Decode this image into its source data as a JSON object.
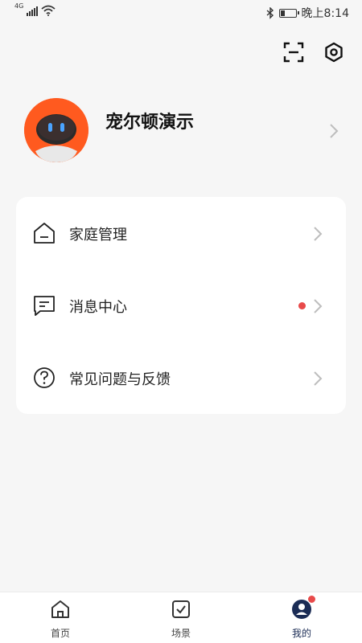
{
  "status_bar": {
    "network": "4G",
    "time": "晚上8:14",
    "battery_level": 0.35
  },
  "header": {
    "icons": [
      "scan-icon",
      "settings-icon"
    ]
  },
  "profile": {
    "username": "宠尔顿演示"
  },
  "menu": {
    "items": [
      {
        "label": "家庭管理",
        "icon": "home-icon"
      },
      {
        "label": "消息中心",
        "icon": "message-icon",
        "has_badge": true
      },
      {
        "label": "常见问题与反馈",
        "icon": "help-icon"
      }
    ]
  },
  "tabbar": {
    "tabs": [
      {
        "label": "首页",
        "icon": "home-tab-icon"
      },
      {
        "label": "场景",
        "icon": "scene-tab-icon"
      },
      {
        "label": "我的",
        "icon": "profile-tab-icon",
        "active": true,
        "has_badge": true
      }
    ]
  },
  "colors": {
    "badge": "#e84a4a",
    "avatar": "#ff5a1f",
    "active_tab": "#1b2c55",
    "background": "#f6f6f6"
  }
}
